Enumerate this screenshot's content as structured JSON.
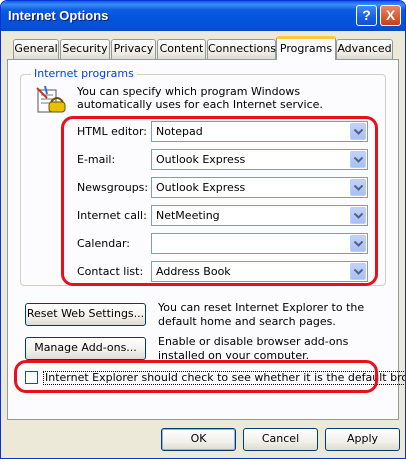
{
  "window": {
    "title": "Internet Options",
    "help_glyph": "?",
    "close_glyph": "X"
  },
  "tabs": [
    {
      "label": "General"
    },
    {
      "label": "Security"
    },
    {
      "label": "Privacy"
    },
    {
      "label": "Content"
    },
    {
      "label": "Connections"
    },
    {
      "label": "Programs",
      "active": true
    },
    {
      "label": "Advanced"
    }
  ],
  "programs": {
    "group_label": "Internet programs",
    "description": "You can specify which program Windows automatically uses for each Internet service.",
    "fields": [
      {
        "label": "HTML editor:",
        "value": "Notepad"
      },
      {
        "label": "E-mail:",
        "value": "Outlook Express"
      },
      {
        "label": "Newsgroups:",
        "value": "Outlook Express"
      },
      {
        "label": "Internet call:",
        "value": "NetMeeting"
      },
      {
        "label": "Calendar:",
        "value": ""
      },
      {
        "label": "Contact list:",
        "value": "Address Book"
      }
    ]
  },
  "reset": {
    "button_label": "Reset Web Settings...",
    "description": "You can reset Internet Explorer to the default home and search pages."
  },
  "addons": {
    "button_label": "Manage Add-ons...",
    "description": "Enable or disable browser add-ons installed on your computer."
  },
  "default_check": {
    "label": "Internet Explorer should check to see whether it is the default browser",
    "checked": false
  },
  "footer": {
    "ok": "OK",
    "cancel": "Cancel",
    "apply": "Apply"
  },
  "colors": {
    "highlight": "#e8101b",
    "titlebar": "#0454dc",
    "group_label": "#0046d5"
  },
  "icons": {
    "program": "programs-icon",
    "dropdown": "chevron-down-icon"
  }
}
